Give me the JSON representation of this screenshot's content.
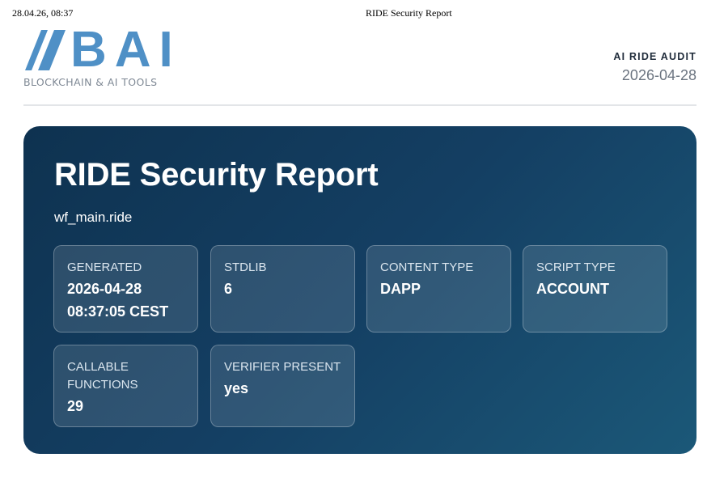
{
  "print_header": {
    "datetime": "28.04.26, 08:37",
    "title": "RIDE Security Report"
  },
  "logo": {
    "wordmark": "BAI",
    "tagline": "BLOCKCHAIN & AI TOOLS",
    "color": "#4f90c6"
  },
  "audit": {
    "label": "AI RIDE AUDIT",
    "date": "2026-04-28"
  },
  "hero": {
    "title": "RIDE Security Report",
    "file": "wf_main.ride",
    "cards": [
      {
        "label": "GENERATED",
        "value": "2026-04-28 08:37:05 CEST"
      },
      {
        "label": "STDLIB",
        "value": "6"
      },
      {
        "label": "CONTENT TYPE",
        "value": "DAPP"
      },
      {
        "label": "SCRIPT TYPE",
        "value": "ACCOUNT"
      },
      {
        "label": "CALLABLE FUNCTIONS",
        "value": "29"
      },
      {
        "label": "VERIFIER PRESENT",
        "value": "yes"
      }
    ]
  }
}
